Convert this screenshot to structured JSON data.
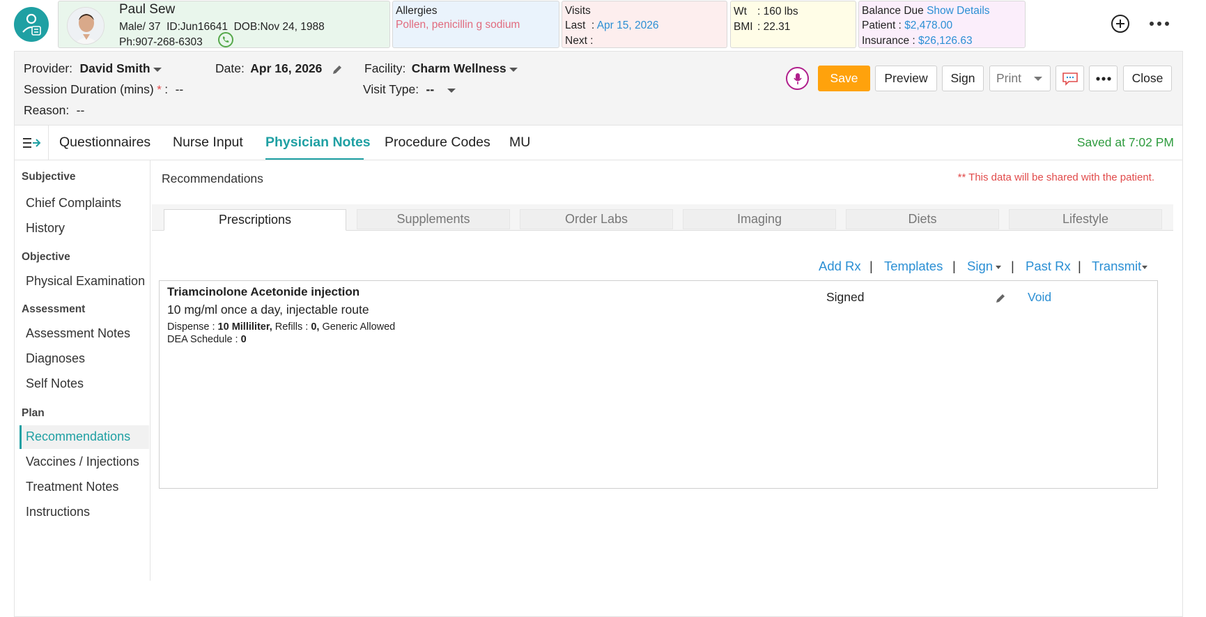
{
  "patient": {
    "name": "Paul Sew",
    "gender_age": "Male/ 37",
    "id": "ID:Jun16641",
    "dob": "DOB:Nov 24, 1988",
    "phone": "Ph:907-268-6303"
  },
  "allergies": {
    "title": "Allergies",
    "value": "Pollen, penicillin g sodium"
  },
  "visits": {
    "title": "Visits",
    "last_label": "Last",
    "last_value": "Apr 15, 2026",
    "next_label": "Next :"
  },
  "vitals": {
    "wt_label": "Wt",
    "wt_value": ": 160 lbs",
    "bmi_label": "BMI",
    "bmi_value": ": 22.31"
  },
  "balance": {
    "title": "Balance Due",
    "show_details": "Show Details",
    "patient_label": "Patient :",
    "patient_value": "$2,478.00",
    "insurance_label": "Insurance :",
    "insurance_value": "$26,126.63"
  },
  "header": {
    "provider_label": "Provider:",
    "provider_value": "David Smith",
    "date_label": "Date:",
    "date_value": "Apr 16, 2026",
    "facility_label": "Facility:",
    "facility_value": "Charm Wellness",
    "session_label": "Session Duration (mins)",
    "session_required": "*",
    "session_colon": ":",
    "session_value": "--",
    "visit_type_label": "Visit Type:",
    "visit_type_value": "--",
    "reason_label": "Reason:",
    "reason_value": "--"
  },
  "toolbar": {
    "save": "Save",
    "preview": "Preview",
    "sign": "Sign",
    "print": "Print",
    "close": "Close"
  },
  "tabs": {
    "items": [
      "Questionnaires",
      "Nurse Input",
      "Physician Notes",
      "Procedure Codes",
      "MU"
    ],
    "saved_status": "Saved at 7:02 PM"
  },
  "sidebar": {
    "sections": [
      {
        "title": "Subjective",
        "items": [
          "Chief Complaints",
          "History"
        ]
      },
      {
        "title": "Objective",
        "items": [
          "Physical Examination"
        ]
      },
      {
        "title": "Assessment",
        "items": [
          "Assessment Notes",
          "Diagnoses",
          "Self Notes"
        ]
      },
      {
        "title": "Plan",
        "items": [
          "Recommendations",
          "Vaccines / Injections",
          "Treatment Notes",
          "Instructions"
        ]
      }
    ]
  },
  "main": {
    "title": "Recommendations",
    "notice": "** This data will be shared with the patient.",
    "subtabs": [
      "Prescriptions",
      "Supplements",
      "Order Labs",
      "Imaging",
      "Diets",
      "Lifestyle"
    ],
    "actions": {
      "add_rx": "Add Rx",
      "templates": "Templates",
      "sign": "Sign",
      "past_rx": "Past Rx",
      "transmit": "Transmit",
      "separator": "|"
    },
    "prescription": {
      "drug": "Triamcinolone Acetonide injection",
      "sig": "10 mg/ml once a day, injectable route",
      "dispense_label": "Dispense :",
      "dispense_value": "10 Milliliter,",
      "refills_label": "Refills :",
      "refills_value": "0,",
      "generic": "Generic Allowed",
      "dea_label": "DEA Schedule :",
      "dea_value": "0",
      "status": "Signed",
      "void": "Void"
    }
  },
  "colors": {
    "accent": "#1fa0a3",
    "save_button": "#ffa20c",
    "link": "#2b8fd4",
    "notice": "#e14b4b",
    "saved": "#2e9b3e"
  }
}
